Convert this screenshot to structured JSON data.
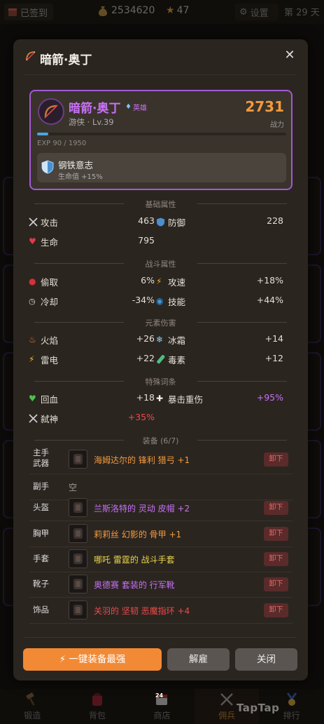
{
  "topbar": {
    "sign_in": "已签到",
    "gold": "2534620",
    "stars": "47",
    "settings": "设置",
    "day": "第 29 天"
  },
  "modal": {
    "title": "暗箭·奥丁",
    "hero": {
      "name": "暗箭·奥丁",
      "rarity": "英雄",
      "class_level": "游侠 · Lv.39",
      "power": "2731",
      "power_label": "战力",
      "exp_text": "EXP 90 / 1950",
      "exp_fraction": 0.046,
      "trait_name": "钢铁意志",
      "trait_desc": "生命值 +15%"
    },
    "sections": {
      "base": "基础属性",
      "combat": "战斗属性",
      "element": "元素伤害",
      "special": "特殊词条",
      "equipment": "装备 (6/7)"
    },
    "stats": {
      "attack_label": "攻击",
      "attack": "463",
      "defense_label": "防御",
      "defense": "228",
      "hp_label": "生命",
      "hp": "795",
      "lifesteal_label": "偷取",
      "lifesteal": "6%",
      "atkspeed_label": "攻速",
      "atkspeed": "+18%",
      "cooldown_label": "冷却",
      "cooldown": "-34%",
      "skill_label": "技能",
      "skill": "+44%",
      "fire_label": "火焰",
      "fire": "+26",
      "ice_label": "冰霜",
      "ice": "+14",
      "thunder_label": "雷电",
      "thunder": "+22",
      "poison_label": "毒素",
      "poison": "+12",
      "regen_label": "回血",
      "regen": "+18",
      "critdmg_label": "暴击重伤",
      "critdmg": "+95%",
      "godslayer_label": "弑神",
      "godslayer": "+35%"
    },
    "equipment": [
      {
        "slot": "主手\n武器",
        "name": "海姆达尔的 锋利 猎弓 +1",
        "color": "#f39a3c",
        "action": "卸下"
      },
      {
        "slot": "副手",
        "name": "空",
        "color": "#999999",
        "action": ""
      },
      {
        "slot": "头盔",
        "name": "兰斯洛特的 灵动 皮帽 +2",
        "color": "#c772f5",
        "action": "卸下"
      },
      {
        "slot": "胸甲",
        "name": "莉莉丝 幻影的 骨甲 +1",
        "color": "#f39a3c",
        "action": "卸下"
      },
      {
        "slot": "手套",
        "name": "哪吒 雷霆的 战斗手套",
        "color": "#e8d64a",
        "action": "卸下"
      },
      {
        "slot": "靴子",
        "name": "奥德赛 套装的 行军靴",
        "color": "#c772f5",
        "action": "卸下"
      },
      {
        "slot": "饰品",
        "name": "关羽的 坚韧 恶魔指环 +4",
        "color": "#ec4a4a",
        "action": "卸下"
      }
    ],
    "buttons": {
      "equip_best": "⚡ 一键装备最强",
      "dismiss": "解雇",
      "close": "关闭"
    }
  },
  "bottomnav": {
    "items": [
      "锻造",
      "背包",
      "商店",
      "佣兵",
      "排行"
    ],
    "calendar_badge": "24",
    "watermark": "TapTap"
  },
  "colors": {
    "accent": "#f28a35",
    "rarity_purple": "#c772f5",
    "legend_orange": "#f39a3c",
    "danger_red": "#ec4a4a"
  }
}
